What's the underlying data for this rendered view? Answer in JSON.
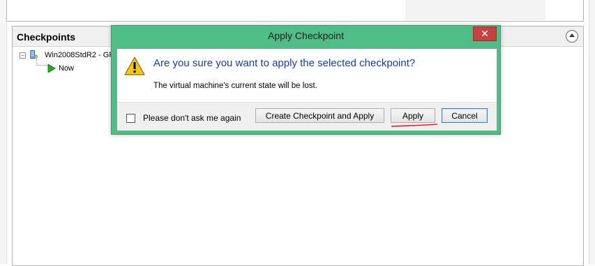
{
  "checkpoints_panel": {
    "title": "Checkpoints",
    "tree": {
      "vm_name": "Win2008StdR2 - GF",
      "expander": "−",
      "children": [
        {
          "label": "Now"
        }
      ]
    }
  },
  "dialog": {
    "title": "Apply Checkpoint",
    "close_glyph": "✕",
    "question": "Are you sure you want to apply the selected checkpoint?",
    "detail": "The virtual machine's current state will be lost.",
    "checkbox": {
      "label": "Please don't ask me again",
      "checked": false
    },
    "buttons": {
      "create_apply": "Create Checkpoint and Apply",
      "apply": "Apply",
      "cancel": "Cancel"
    }
  },
  "colors": {
    "dialog_frame": "#4fbd85",
    "close_button": "#c74343",
    "question_text": "#1b3d98",
    "annotation_underline": "#e02020"
  },
  "icons": [
    "warning-icon",
    "vm-icon",
    "play-icon",
    "collapse-icon",
    "close-icon"
  ]
}
